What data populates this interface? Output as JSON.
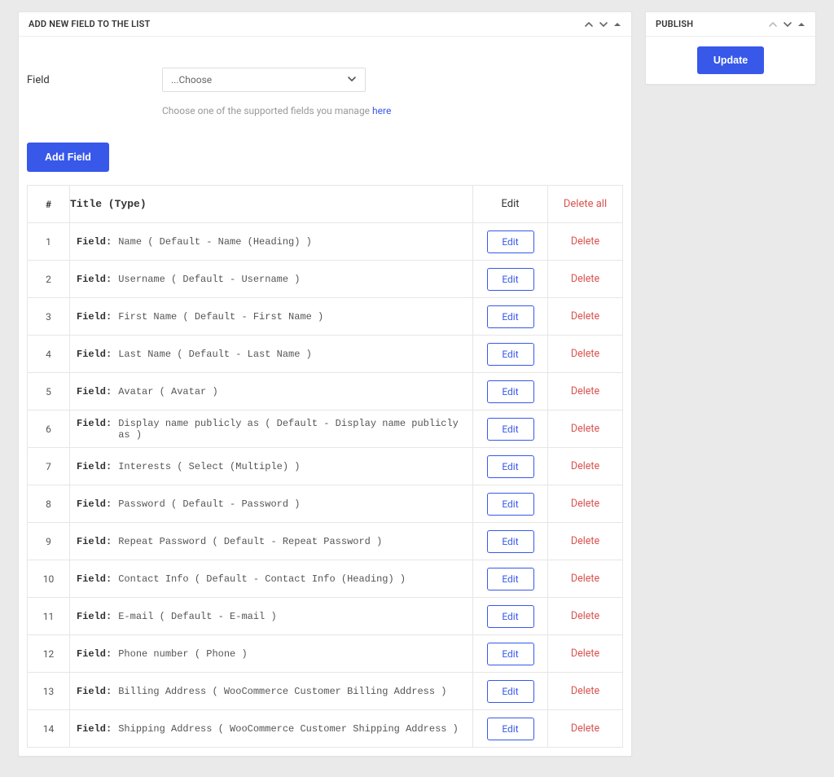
{
  "main": {
    "header": "ADD NEW FIELD TO THE LIST",
    "field_label": "Field",
    "select_placeholder": "...Choose",
    "helper_prefix": "Choose one of the supported fields you manage ",
    "helper_link": "here",
    "add_button": "Add Field"
  },
  "table": {
    "head_index": "#",
    "head_title": "Title (Type)",
    "head_edit": "Edit",
    "head_delete": "Delete all",
    "row_label": "Field:",
    "edit_btn": "Edit",
    "delete_btn": "Delete",
    "rows": [
      {
        "n": "1",
        "t": "Name ( Default - Name (Heading) )"
      },
      {
        "n": "2",
        "t": "Username ( Default - Username )"
      },
      {
        "n": "3",
        "t": "First Name ( Default - First Name )"
      },
      {
        "n": "4",
        "t": "Last Name ( Default - Last Name )"
      },
      {
        "n": "5",
        "t": "Avatar ( Avatar )"
      },
      {
        "n": "6",
        "t": "Display name publicly as ( Default - Display name publicly as )"
      },
      {
        "n": "7",
        "t": "Interests ( Select (Multiple) )"
      },
      {
        "n": "8",
        "t": "Password ( Default - Password )"
      },
      {
        "n": "9",
        "t": "Repeat Password ( Default - Repeat Password )"
      },
      {
        "n": "10",
        "t": "Contact Info ( Default - Contact Info (Heading) )"
      },
      {
        "n": "11",
        "t": "E-mail ( Default - E-mail )"
      },
      {
        "n": "12",
        "t": "Phone number ( Phone )"
      },
      {
        "n": "13",
        "t": "Billing Address ( WooCommerce Customer Billing Address )"
      },
      {
        "n": "14",
        "t": "Shipping Address ( WooCommerce Customer Shipping Address )"
      }
    ]
  },
  "publish": {
    "header": "PUBLISH",
    "update": "Update"
  }
}
